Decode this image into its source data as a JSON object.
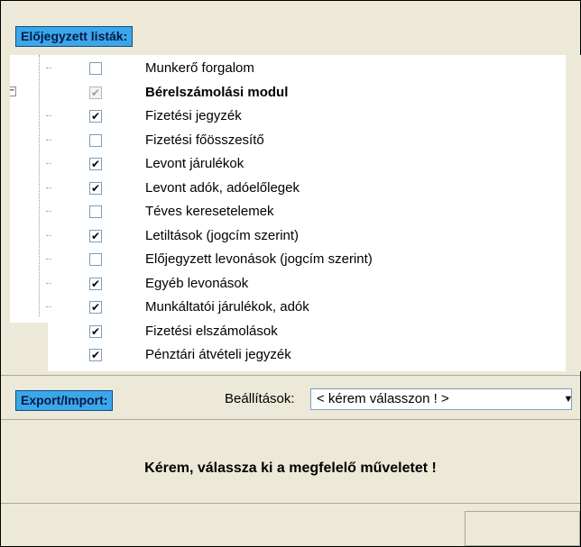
{
  "header": {
    "button_label": "Előjegyzett listák:"
  },
  "tree": {
    "items": [
      {
        "label": "Munkerő forgalom",
        "checked": false,
        "bold": false
      },
      {
        "label": "Bérelszámolási modul",
        "checked": true,
        "bold": true,
        "gray": true,
        "expander": "−"
      },
      {
        "label": "Fizetési jegyzék",
        "checked": true,
        "bold": false
      },
      {
        "label": "Fizetési főösszesítő",
        "checked": false,
        "bold": false
      },
      {
        "label": "Levont járulékok",
        "checked": true,
        "bold": false
      },
      {
        "label": "Levont adók, adóelőlegek",
        "checked": true,
        "bold": false
      },
      {
        "label": "Téves keresetelemek",
        "checked": false,
        "bold": false
      },
      {
        "label": "Letiltások (jogcím szerint)",
        "checked": true,
        "bold": false
      },
      {
        "label": "Előjegyzett levonások (jogcím szerint)",
        "checked": false,
        "bold": false
      },
      {
        "label": "Egyéb levonások",
        "checked": true,
        "bold": false
      },
      {
        "label": "Munkáltatói járulékok, adók",
        "checked": true,
        "bold": false
      },
      {
        "label": "Fizetési elszámolások",
        "checked": true,
        "bold": false
      },
      {
        "label": "Pénztári átvételi jegyzék",
        "checked": true,
        "bold": false
      }
    ]
  },
  "toolbar": {
    "export_label": "Export/Import:",
    "settings_label": "Beállítások:",
    "settings_value": "< kérem válasszon ! >",
    "arrow_glyph": "▼"
  },
  "message": "Kérem, válassza ki a megfelelő műveletet !"
}
